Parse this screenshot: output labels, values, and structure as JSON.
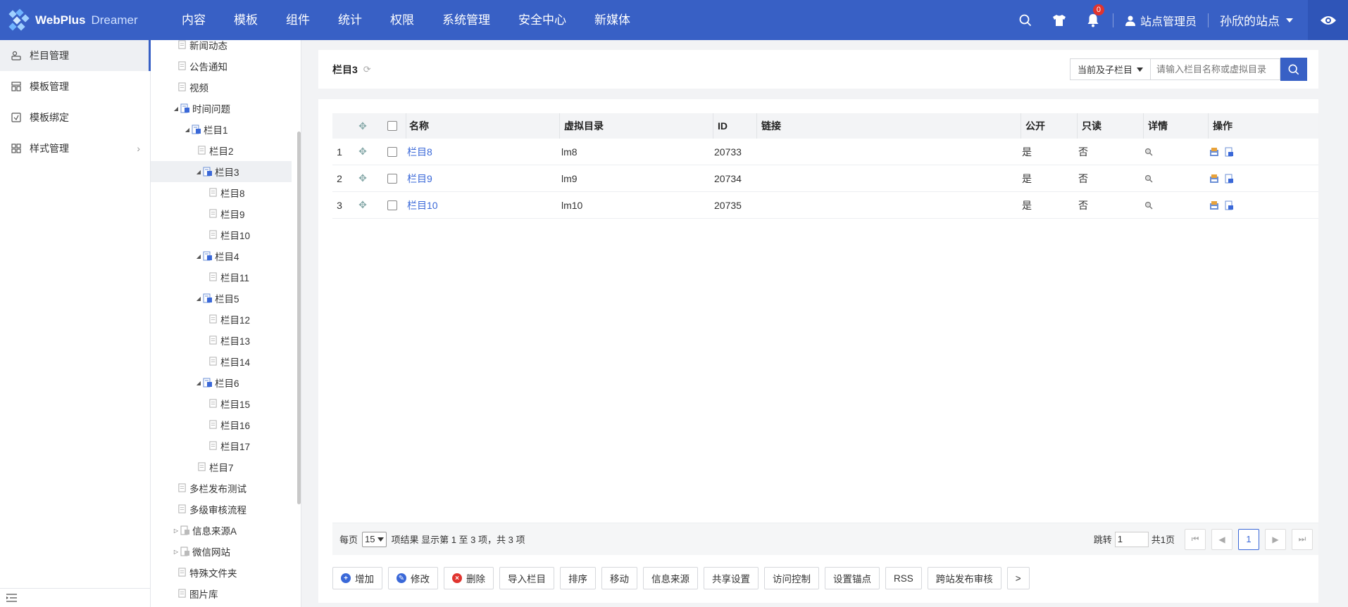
{
  "app": {
    "logo_text": "WebPlus",
    "logo_sub": "Dreamer"
  },
  "nav": [
    "内容",
    "模板",
    "组件",
    "统计",
    "权限",
    "系统管理",
    "安全中心",
    "新媒体"
  ],
  "topbar": {
    "notif_count": "0",
    "user_name": "站点管理员",
    "site_name": "孙欣的站点"
  },
  "sidebar": {
    "items": [
      {
        "label": "栏目管理",
        "icon": "column-icon"
      },
      {
        "label": "模板管理",
        "icon": "template-icon"
      },
      {
        "label": "模板绑定",
        "icon": "bind-icon"
      },
      {
        "label": "样式管理",
        "icon": "style-icon"
      }
    ]
  },
  "tree": [
    {
      "label": "新闻动态"
    },
    {
      "label": "公告通知"
    },
    {
      "label": "视频"
    },
    {
      "label": "时间问题"
    },
    {
      "label": "栏目1"
    },
    {
      "label": "栏目2"
    },
    {
      "label": "栏目3"
    },
    {
      "label": "栏目8"
    },
    {
      "label": "栏目9"
    },
    {
      "label": "栏目10"
    },
    {
      "label": "栏目4"
    },
    {
      "label": "栏目11"
    },
    {
      "label": "栏目5"
    },
    {
      "label": "栏目12"
    },
    {
      "label": "栏目13"
    },
    {
      "label": "栏目14"
    },
    {
      "label": "栏目6"
    },
    {
      "label": "栏目15"
    },
    {
      "label": "栏目16"
    },
    {
      "label": "栏目17"
    },
    {
      "label": "栏目7"
    },
    {
      "label": "多栏发布测试"
    },
    {
      "label": "多级审核流程"
    },
    {
      "label": "信息来源A"
    },
    {
      "label": "微信网站"
    },
    {
      "label": "特殊文件夹"
    },
    {
      "label": "图片库"
    }
  ],
  "header": {
    "title": "栏目3",
    "scope_select": "当前及子栏目",
    "search_placeholder": "请输入栏目名称或虚拟目录"
  },
  "table": {
    "columns": {
      "name": "名称",
      "dir": "虚拟目录",
      "id": "ID",
      "link": "链接",
      "public": "公开",
      "readonly": "只读",
      "detail": "详情",
      "ops": "操作"
    },
    "rows": [
      {
        "idx": "1",
        "name": "栏目8",
        "dir": "lm8",
        "id": "20733",
        "link": "",
        "public": "是",
        "readonly": "否"
      },
      {
        "idx": "2",
        "name": "栏目9",
        "dir": "lm9",
        "id": "20734",
        "link": "",
        "public": "是",
        "readonly": "否"
      },
      {
        "idx": "3",
        "name": "栏目10",
        "dir": "lm10",
        "id": "20735",
        "link": "",
        "public": "是",
        "readonly": "否"
      }
    ]
  },
  "pager": {
    "per_page_label": "每页",
    "per_page_value": "15",
    "result_text": "项结果 显示第 1 至 3 项，共 3 项",
    "jump_label": "跳转",
    "jump_value": "1",
    "total_pages": "共1页",
    "current_page": "1"
  },
  "actions": [
    "增加",
    "修改",
    "删除",
    "导入栏目",
    "排序",
    "移动",
    "信息来源",
    "共享设置",
    "访问控制",
    "设置锚点",
    "RSS",
    "跨站发布审核",
    ">"
  ],
  "colors": {
    "brand": "#3860c5",
    "link": "#3a68d8",
    "add": "#3a68d8",
    "edit": "#3a68d8",
    "delete": "#e0342f"
  }
}
